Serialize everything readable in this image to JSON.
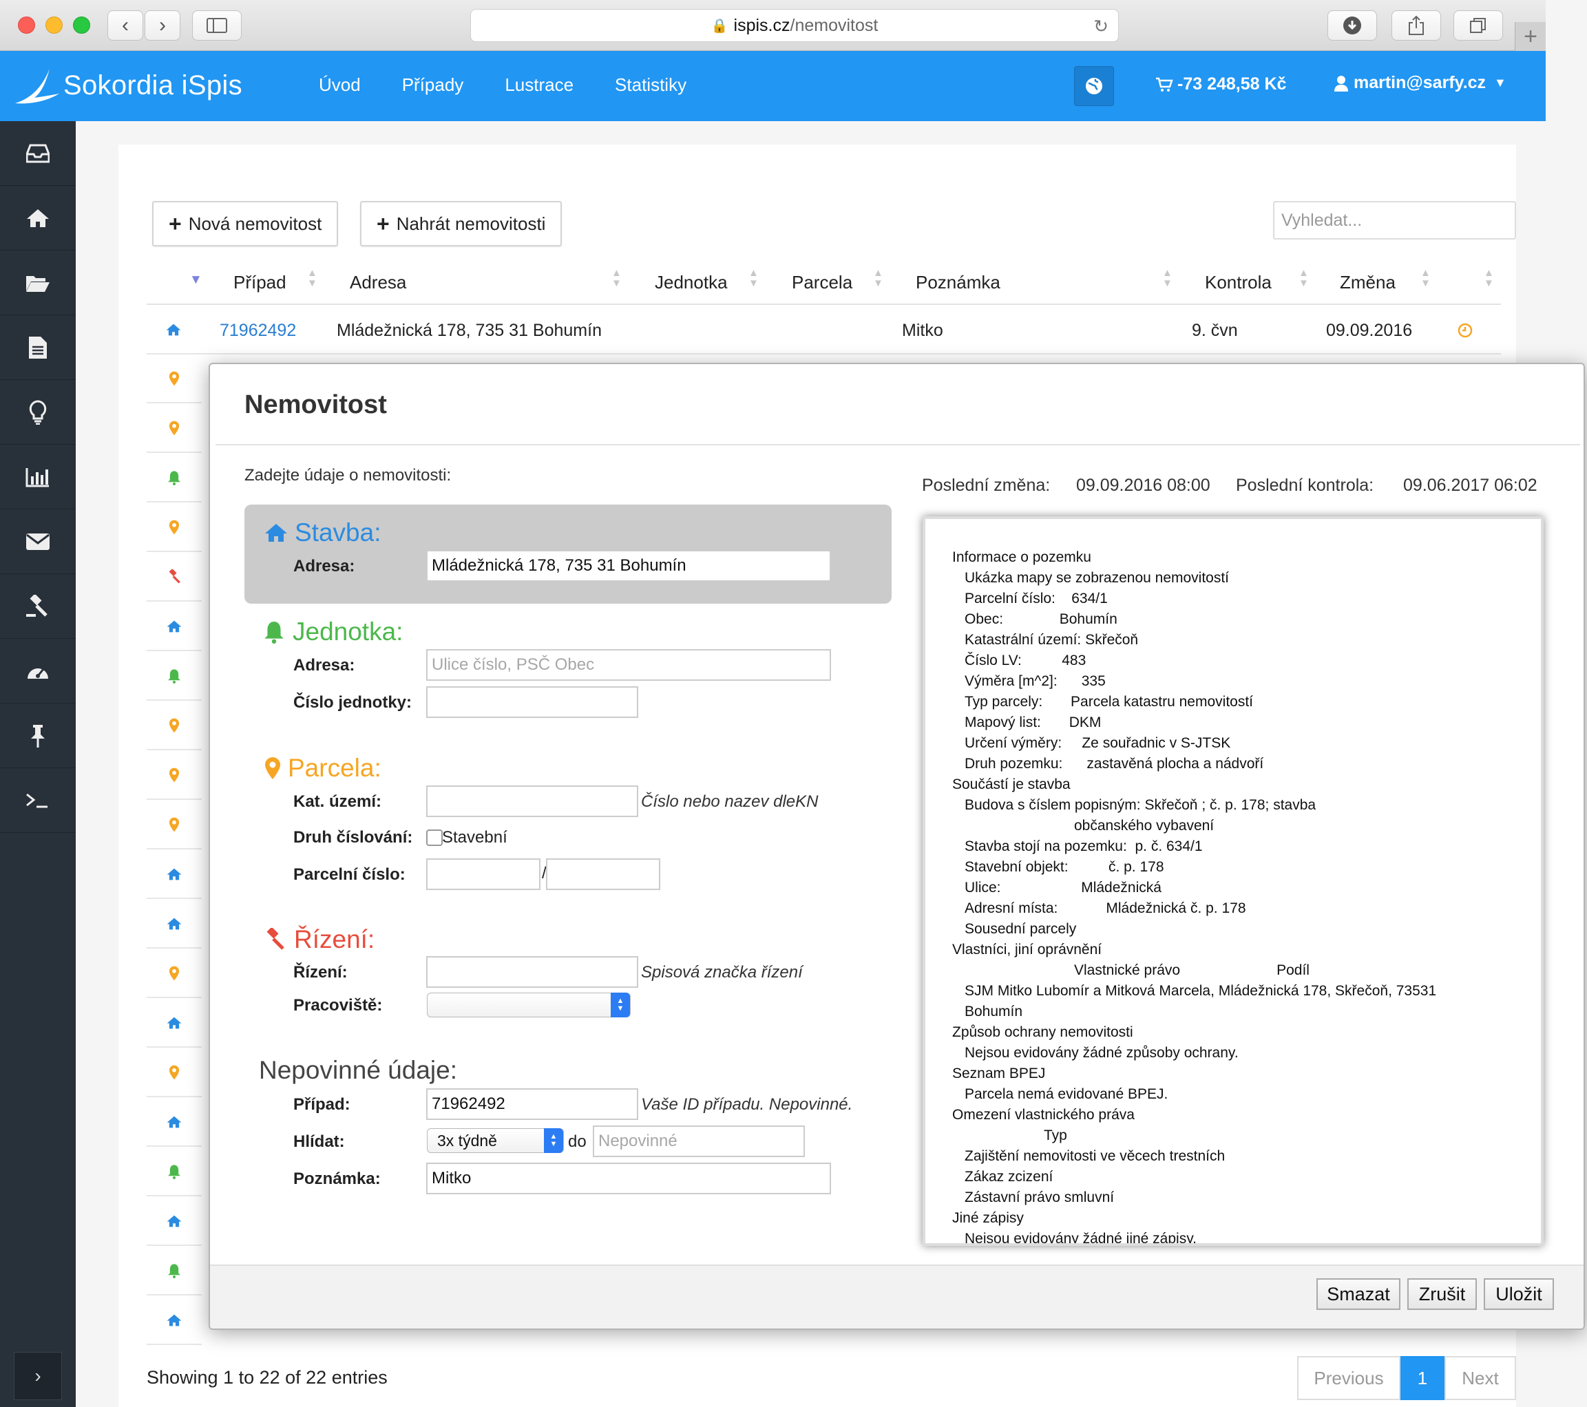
{
  "browser": {
    "url_host": "ispis.cz",
    "url_path": "/nemovitost"
  },
  "app": {
    "brand": "Sokordia iSpis",
    "nav": [
      "Úvod",
      "Případy",
      "Lustrace",
      "Statistiky"
    ],
    "cart": "-73 248,58 Kč",
    "user": "martin@sarfy.cz"
  },
  "sidebar": {
    "items": [
      "inbox-icon",
      "home-icon",
      "folder-open-icon",
      "document-icon",
      "lightbulb-icon",
      "bar-chart-icon",
      "envelope-icon",
      "gavel-icon",
      "dashboard-icon",
      "pin-icon",
      "terminal-icon"
    ]
  },
  "toolbar": {
    "new_label": "Nová nemovitost",
    "upload_label": "Nahrát nemovitosti",
    "search_placeholder": "Vyhledat..."
  },
  "table": {
    "headers": [
      "Případ",
      "Adresa",
      "Jednotka",
      "Parcela",
      "Poznámka",
      "Kontrola",
      "Změna"
    ],
    "first_row": {
      "pripad": "71962492",
      "adresa": "Mládežnická 178, 735 31 Bohumín",
      "poznamka": "Mitko",
      "kontrola": "9. čvn",
      "zmena": "09.09.2016"
    },
    "row_icons": [
      "pin",
      "pin",
      "bell",
      "pin",
      "gavel",
      "home",
      "bell",
      "pin",
      "pin",
      "pin",
      "home",
      "home",
      "pin",
      "home",
      "pin",
      "home",
      "bell",
      "home",
      "bell",
      "home"
    ],
    "showing": "Showing 1 to 22 of 22 entries",
    "pager": {
      "prev": "Previous",
      "current": "1",
      "next": "Next"
    }
  },
  "modal": {
    "title": "Nemovitost",
    "intro": "Zadejte údaje o nemovitosti:",
    "last_change_label": "Poslední změna:",
    "last_change_value": "09.09.2016 08:00",
    "last_check_label": "Poslední kontrola:",
    "last_check_value": "09.06.2017 06:02",
    "stavba": {
      "heading": "Stavba:",
      "adresa_label": "Adresa:",
      "adresa_value": "Mládežnická 178, 735 31 Bohumín"
    },
    "jednotka": {
      "heading": "Jednotka:",
      "adresa_label": "Adresa:",
      "adresa_placeholder": "Ulice číslo, PSČ Obec",
      "cislo_label": "Číslo jednotky:"
    },
    "parcela": {
      "heading": "Parcela:",
      "kat_label": "Kat. území:",
      "kat_hint": "Číslo nebo nazev dleKN",
      "druh_label": "Druh číslování:",
      "druh_checkbox": "Stavební",
      "cislo_label": "Parcelní číslo:",
      "separator": "/"
    },
    "rizeni": {
      "heading": "Řízení:",
      "rizeni_label": "Řízení:",
      "rizeni_hint": "Spisová značka řízení",
      "pracoviste_label": "Pracoviště:"
    },
    "nepovinne": {
      "heading": "Nepovinné údaje:",
      "pripad_label": "Případ:",
      "pripad_value": "71962492",
      "pripad_hint": "Vaše ID případu. Nepovinné.",
      "hlidat_label": "Hlídat:",
      "hlidat_value": "3x týdně",
      "do_label": "do",
      "do_placeholder": "Nepovinné",
      "poznamka_label": "Poznámka:",
      "poznamka_value": "Mitko"
    },
    "info_lines": [
      [
        "Informace o pozemku",
        0
      ],
      [
        "Ukázka mapy se zobrazenou nemovitostí",
        1
      ],
      [
        "Parcelní číslo:    634/1",
        1
      ],
      [
        "Obec:              Bohumín",
        1
      ],
      [
        "Katastrální území: Skřečoň",
        1
      ],
      [
        "Číslo LV:          483",
        1
      ],
      [
        "Výměra [m^2]:      335",
        1
      ],
      [
        "Typ parcely:       Parcela katastru nemovitostí",
        1
      ],
      [
        "Mapový list:       DKM",
        1
      ],
      [
        "Určení výměry:     Ze souřadnic v S-JTSK",
        1
      ],
      [
        "Druh pozemku:      zastavěná plocha a nádvoří",
        1
      ],
      [
        "Součástí je stavba",
        0
      ],
      [
        "Budova s číslem popisným: Skřečoň ; č. p. 178; stavba",
        1
      ],
      [
        "občanského vybavení",
        2
      ],
      [
        "Stavba stojí na pozemku:  p. č. 634/1",
        1
      ],
      [
        "Stavební objekt:          č. p. 178",
        1
      ],
      [
        "Ulice:                    Mládežnická",
        1
      ],
      [
        "Adresní místa:            Mládežnická č. p. 178",
        1
      ],
      [
        "Sousední parcely",
        1
      ],
      [
        "Vlastníci, jiní oprávnění",
        0
      ],
      [
        "Vlastnické právo                        Podíl",
        2
      ],
      [
        "SJM Mitko Lubomír a Mitková Marcela, Mládežnická 178, Skřečoň, 73531",
        1
      ],
      [
        "Bohumín",
        1
      ],
      [
        "Způsob ochrany nemovitosti",
        0
      ],
      [
        "Nejsou evidovány žádné způsoby ochrany.",
        1
      ],
      [
        "Seznam BPEJ",
        0
      ],
      [
        "Parcela nemá evidované BPEJ.",
        1
      ],
      [
        "Omezení vlastnického práva",
        0
      ],
      [
        "Typ",
        3
      ],
      [
        "Zajištění nemovitosti ve věcech trestních",
        1
      ],
      [
        "Zákaz zcizení",
        1
      ],
      [
        "Zástavní právo smluvní",
        1
      ],
      [
        "Jiné zápisy",
        0
      ],
      [
        "Nejsou evidovány žádné jiné zápisy.",
        1
      ]
    ],
    "buttons": {
      "delete": "Smazat",
      "cancel": "Zrušit",
      "save": "Uložit"
    }
  },
  "colors": {
    "brand_blue": "#2196f3",
    "stavba": "#2b8be0",
    "jednotka": "#4cb84c",
    "parcela": "#f5a623",
    "rizeni": "#e74c3c",
    "sidebar": "#283039"
  }
}
